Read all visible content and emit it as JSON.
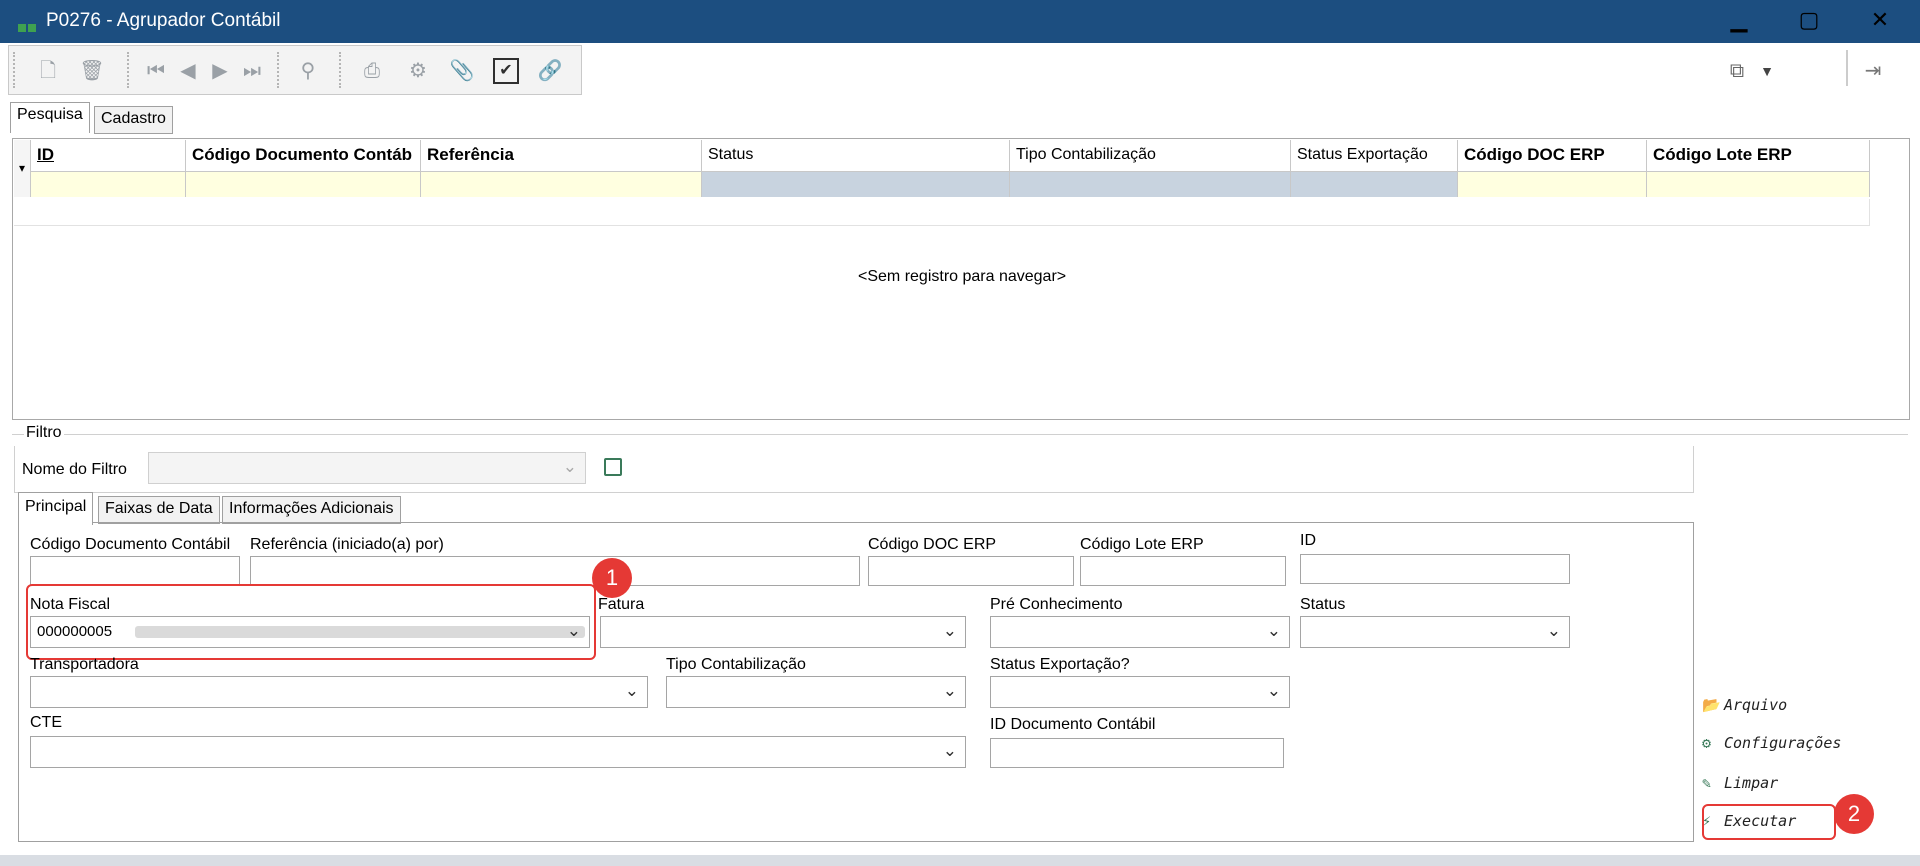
{
  "window": {
    "title": "P0276 - Agrupador Contábil",
    "minimize": "▁",
    "maximize": "▢",
    "close": "✕"
  },
  "toolbar": {
    "icons": [
      "new-document-icon",
      "delete-icon",
      "first-record-icon",
      "previous-record-icon",
      "next-record-icon",
      "last-record-icon",
      "search-binoculars-icon",
      "print-icon",
      "settings-gear-icon",
      "attachment-clip-icon",
      "checkbox-icon",
      "link-icon",
      "export-icon",
      "exit-icon"
    ]
  },
  "top_tabs": [
    "Pesquisa",
    "Cadastro"
  ],
  "grid": {
    "columns": [
      "ID",
      "Código Documento Contáb",
      "Referência",
      "Status",
      "Tipo Contabilização",
      "Status Exportação",
      "Código DOC ERP",
      "Código Lote ERP"
    ],
    "empty_message": "<Sem registro para navegar>",
    "filter_marker": "▾"
  },
  "filter": {
    "group_label": "Filtro",
    "name_label": "Nome do Filtro",
    "name_value": "",
    "tabs": [
      "Principal",
      "Faixas de Data",
      "Informações Adicionais"
    ],
    "fields": {
      "codigo_documento_contabil": {
        "label": "Código Documento Contábil",
        "value": ""
      },
      "referencia": {
        "label": "Referência (iniciado(a) por)",
        "value": ""
      },
      "codigo_doc_erp": {
        "label": "Código DOC ERP",
        "value": ""
      },
      "codigo_lote_erp": {
        "label": "Código Lote ERP",
        "value": ""
      },
      "id": {
        "label": "ID",
        "value": ""
      },
      "nota_fiscal": {
        "label": "Nota Fiscal",
        "value": "000000005"
      },
      "fatura": {
        "label": "Fatura",
        "value": ""
      },
      "pre_conhecimento": {
        "label": "Pré Conhecimento",
        "value": ""
      },
      "status": {
        "label": "Status",
        "value": ""
      },
      "transportadora": {
        "label": "Transportadora",
        "value": ""
      },
      "tipo_contabilizacao": {
        "label": "Tipo Contabilização",
        "value": ""
      },
      "status_exportacao": {
        "label": "Status Exportação?",
        "value": ""
      },
      "cte": {
        "label": "CTE",
        "value": ""
      },
      "id_documento_contabil": {
        "label": "ID Documento Contábil",
        "value": ""
      }
    }
  },
  "actions": {
    "arquivo": "Arquivo",
    "configuracoes": "Configurações",
    "limpar": "Limpar",
    "executar": "Executar"
  },
  "annotations": {
    "one": "1",
    "two": "2"
  },
  "colors": {
    "titlebar": "#1c4e80",
    "highlight": "#e53935",
    "filter_yellow": "#ffffe0",
    "filter_blue": "#c8d3df"
  }
}
